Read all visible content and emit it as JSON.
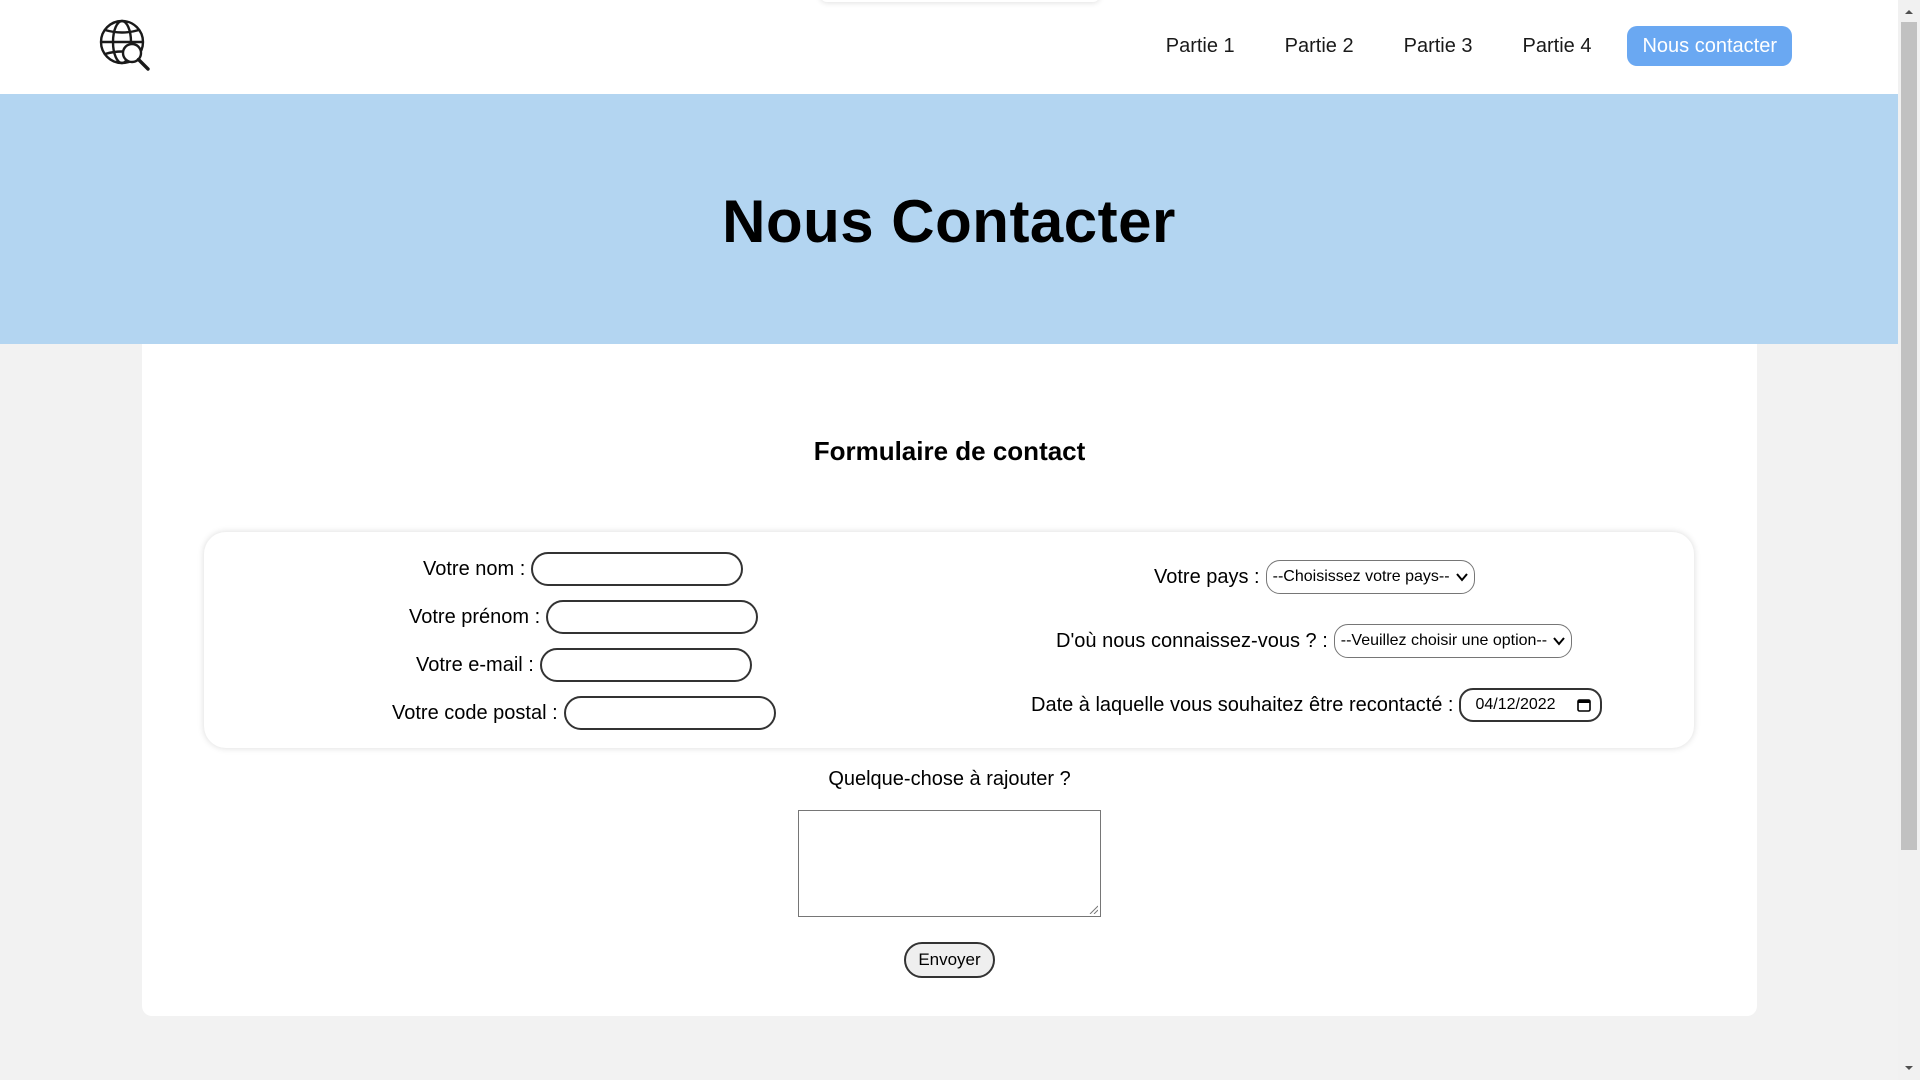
{
  "nav": {
    "items": [
      "Partie 1",
      "Partie 2",
      "Partie 3",
      "Partie 4"
    ],
    "cta": "Nous contacter"
  },
  "hero": {
    "title": "Nous Contacter"
  },
  "form": {
    "title": "Formulaire de contact",
    "name_label": "Votre nom :",
    "firstname_label": "Votre prénom :",
    "email_label": "Votre e-mail :",
    "postal_label": "Votre code postal :",
    "country_label": "Votre pays :",
    "country_value": "--Choisissez votre pays--",
    "source_label": "D'où nous connaissez-vous ? :",
    "source_value": "--Veuillez choisir une option--",
    "date_label": "Date à laquelle vous souhaitez être recontacté :",
    "date_value": "04/12/2022",
    "extra_label": "Quelque-chose à rajouter ?",
    "submit": "Envoyer"
  },
  "colors": {
    "hero_bg": "#b3d5f1",
    "cta_bg": "#6aa8f2",
    "page_bg": "#f2f2f2"
  }
}
